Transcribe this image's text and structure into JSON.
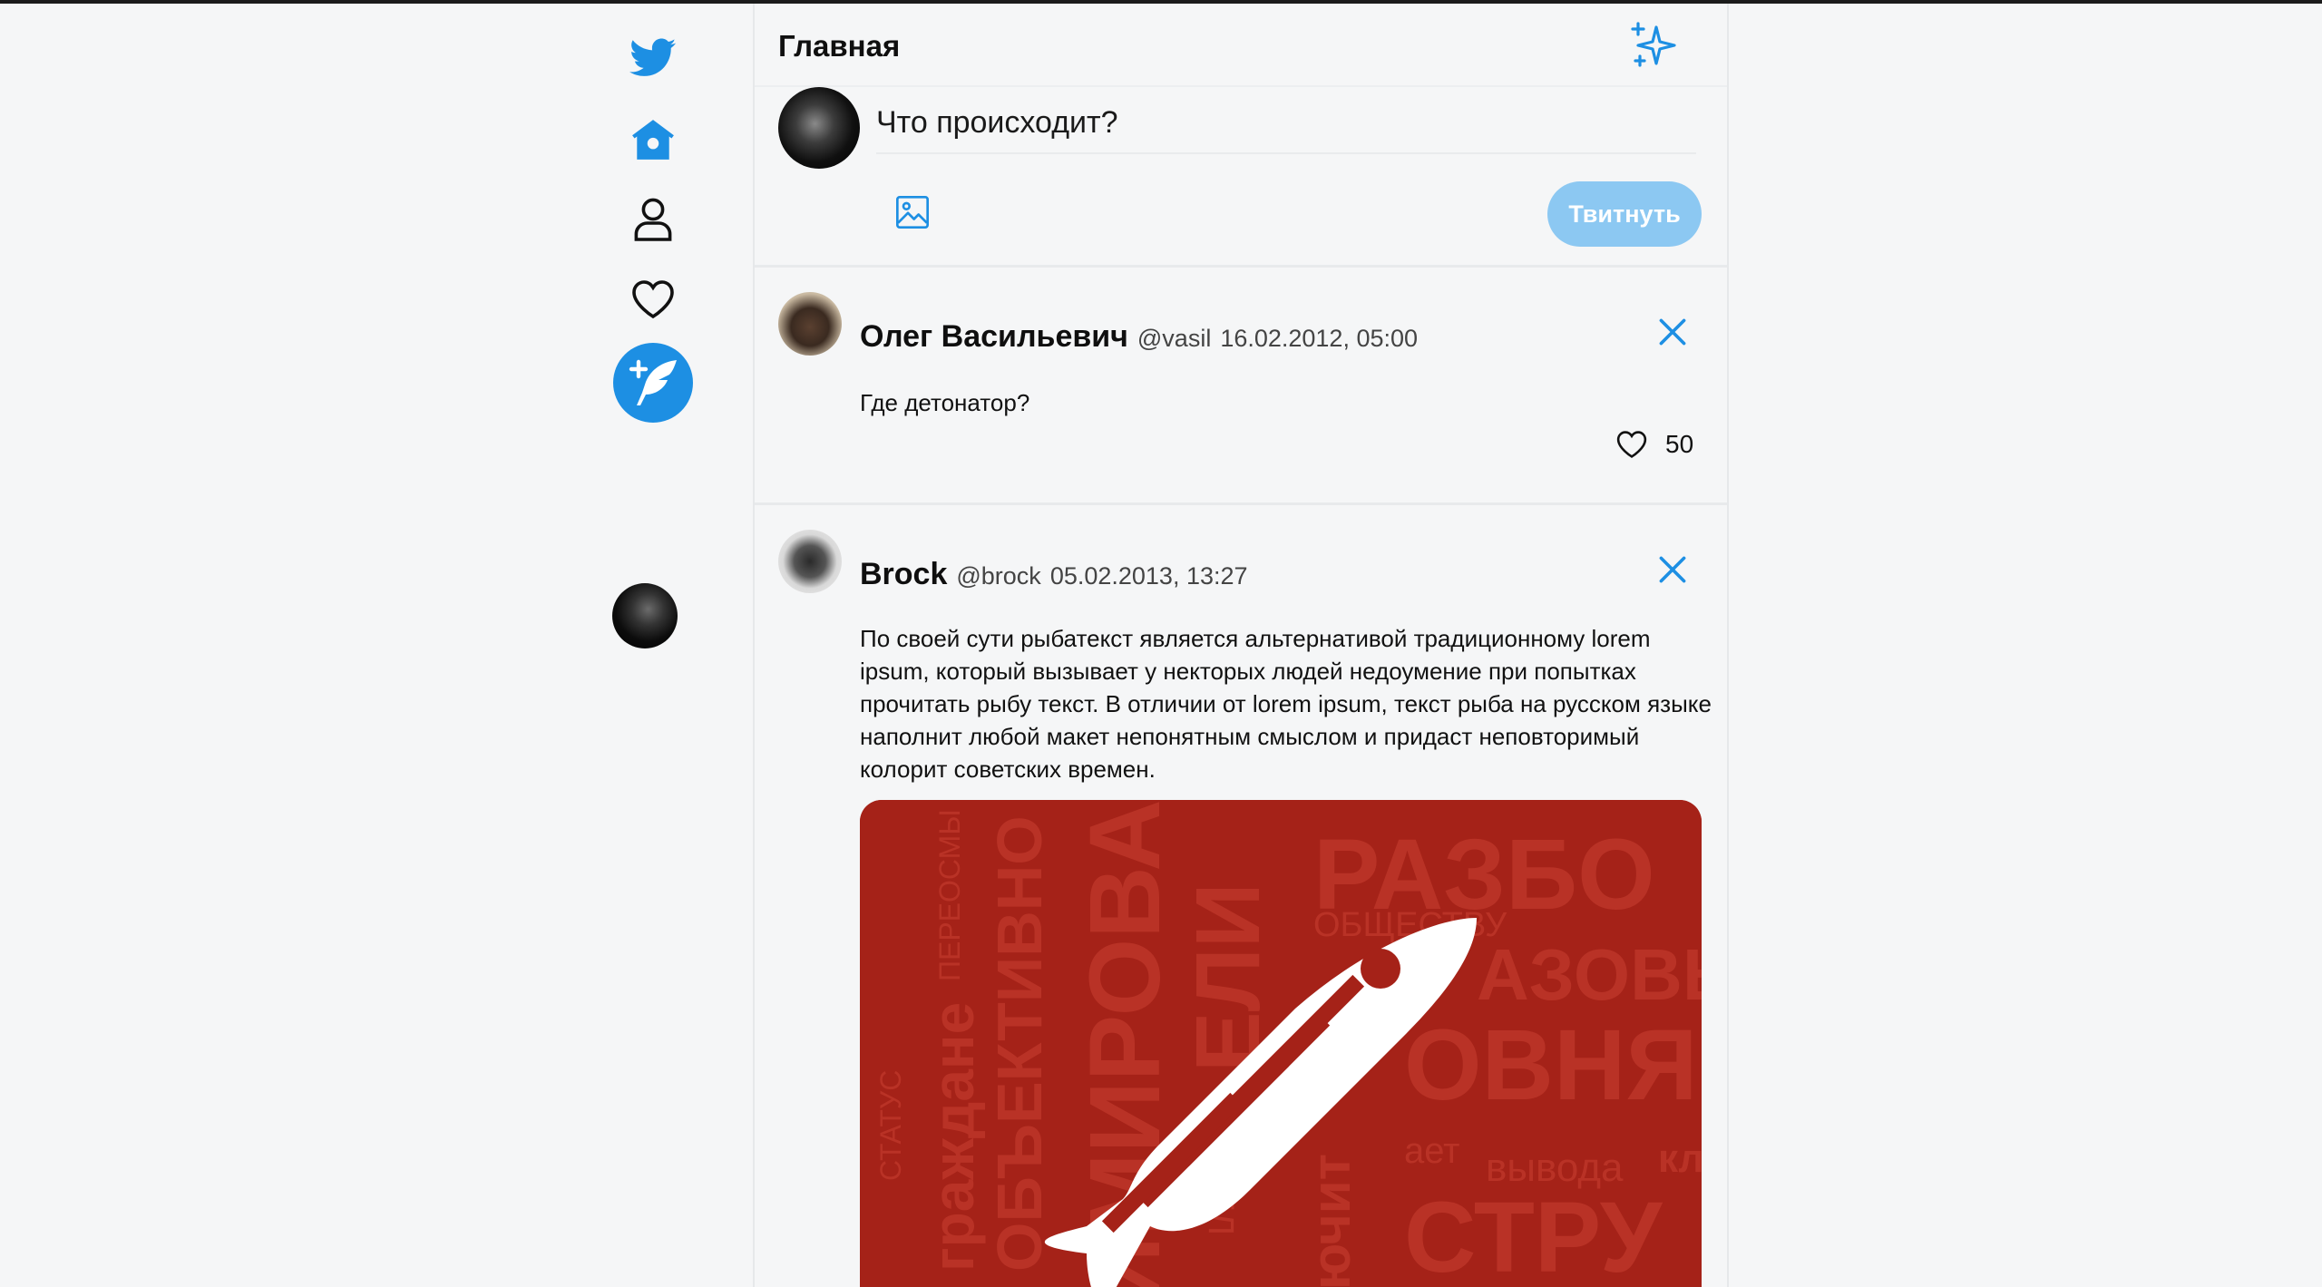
{
  "header": {
    "title": "Главная"
  },
  "composer": {
    "placeholder": "Что происходит?",
    "tweet_button": "Твитнуть"
  },
  "tweets": [
    {
      "name": "Олег Васильевич",
      "handle": "@vasil",
      "date": "16.02.2012, 05:00",
      "text": "Где детонатор?",
      "likes": "50"
    },
    {
      "name": "Brock",
      "handle": "@brock",
      "date": "05.02.2013, 13:27",
      "text": "По своей сути рыбатекст является альтернативой традиционному lorem ipsum, который вызывает у некторых людей недоумение при попытках прочитать рыбу текст. В отличии от lorem ipsum, текст рыба на русском языке наполнит любой макет непонятным смыслом и придаст неповторимый колорит советских времен.",
      "image_words": [
        "РАЗБО",
        "ОВНЯ",
        "СТРУ",
        "ИМИРОВА",
        "ОБЪЕКТИВНО",
        "гражданe",
        "ЕЛИ",
        "АЗОВЫ",
        "ОБЩЕСТВУ",
        "вывода",
        "клю",
        "СТАТУС",
        "ПЕРЕОСМЫ",
        "ДЕЛ",
        "ючит",
        "ает"
      ]
    }
  ],
  "colors": {
    "accent": "#1d8fe3",
    "tweet_button_bg": "#8cc8f2",
    "image_bg": "#a52218"
  }
}
